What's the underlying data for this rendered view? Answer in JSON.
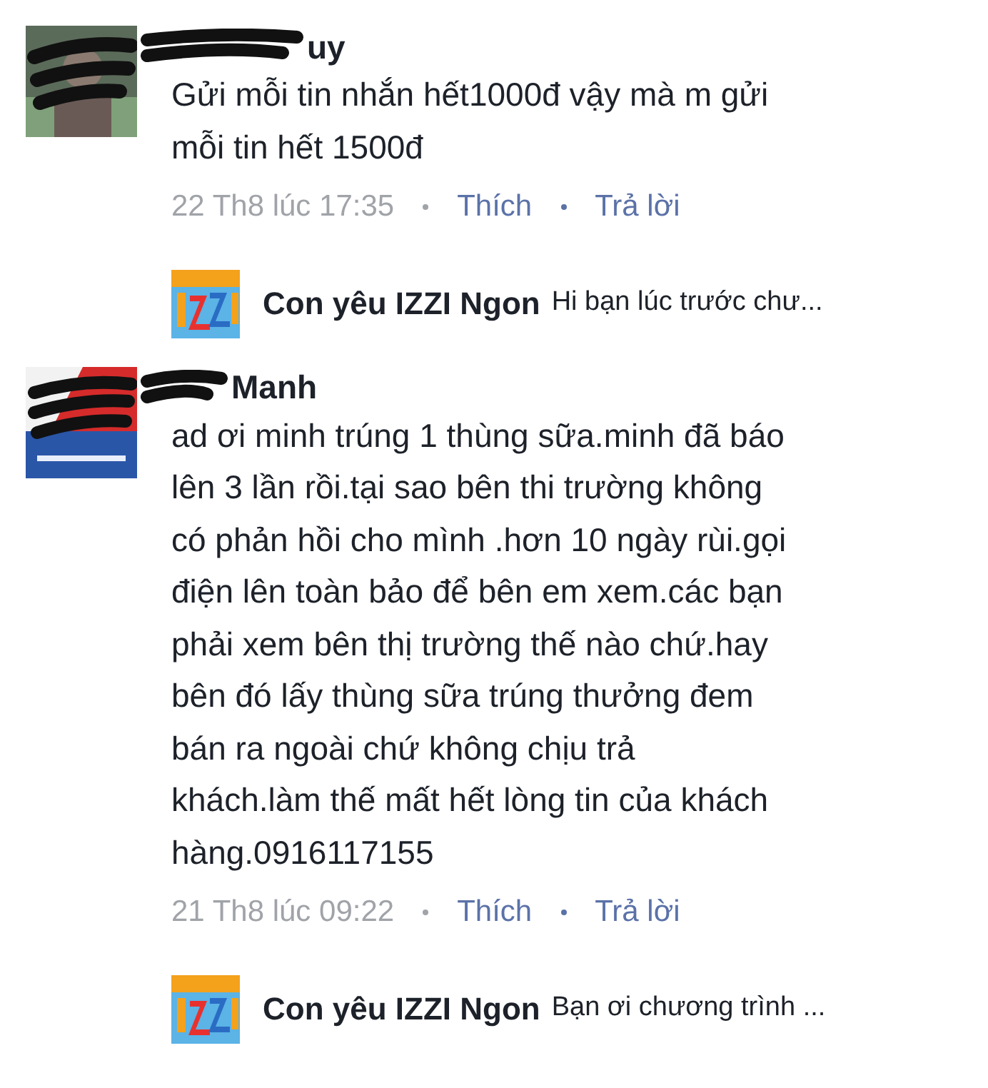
{
  "comments": [
    {
      "name": "uy",
      "text": "Gửi mỗi tin nhắn hết1000đ vậy mà m gửi\nmỗi tin hết 1500đ",
      "time": "22 Th8 lúc 17:35",
      "like": "Thích",
      "reply": "Trả lời",
      "reply_preview": {
        "name": "Con yêu IZZI Ngon",
        "text": "Hi bạn lúc trước chư..."
      }
    },
    {
      "name": "Manh",
      "text": "ad ơi minh trúng 1 thùng sữa.minh đã báo\nlên 3 lần rồi.tại sao bên thi trường không\ncó phản hồi cho mình .hơn 10 ngày rùi.gọi\nđiện lên toàn bảo để bên em xem.các bạn\nphải xem bên thị trường thế nào chứ.hay\nbên đó lấy thùng sữa trúng thưởng đem\nbán ra ngoài chứ không chịu trả\nkhách.làm thế mất hết lòng tin của khách\nhàng.0916117155",
      "time": "21 Th8 lúc 09:22",
      "like": "Thích",
      "reply": "Trả lời",
      "reply_preview": {
        "name": "Con yêu IZZI Ngon",
        "text": "Bạn ơi chương trình ..."
      }
    }
  ]
}
